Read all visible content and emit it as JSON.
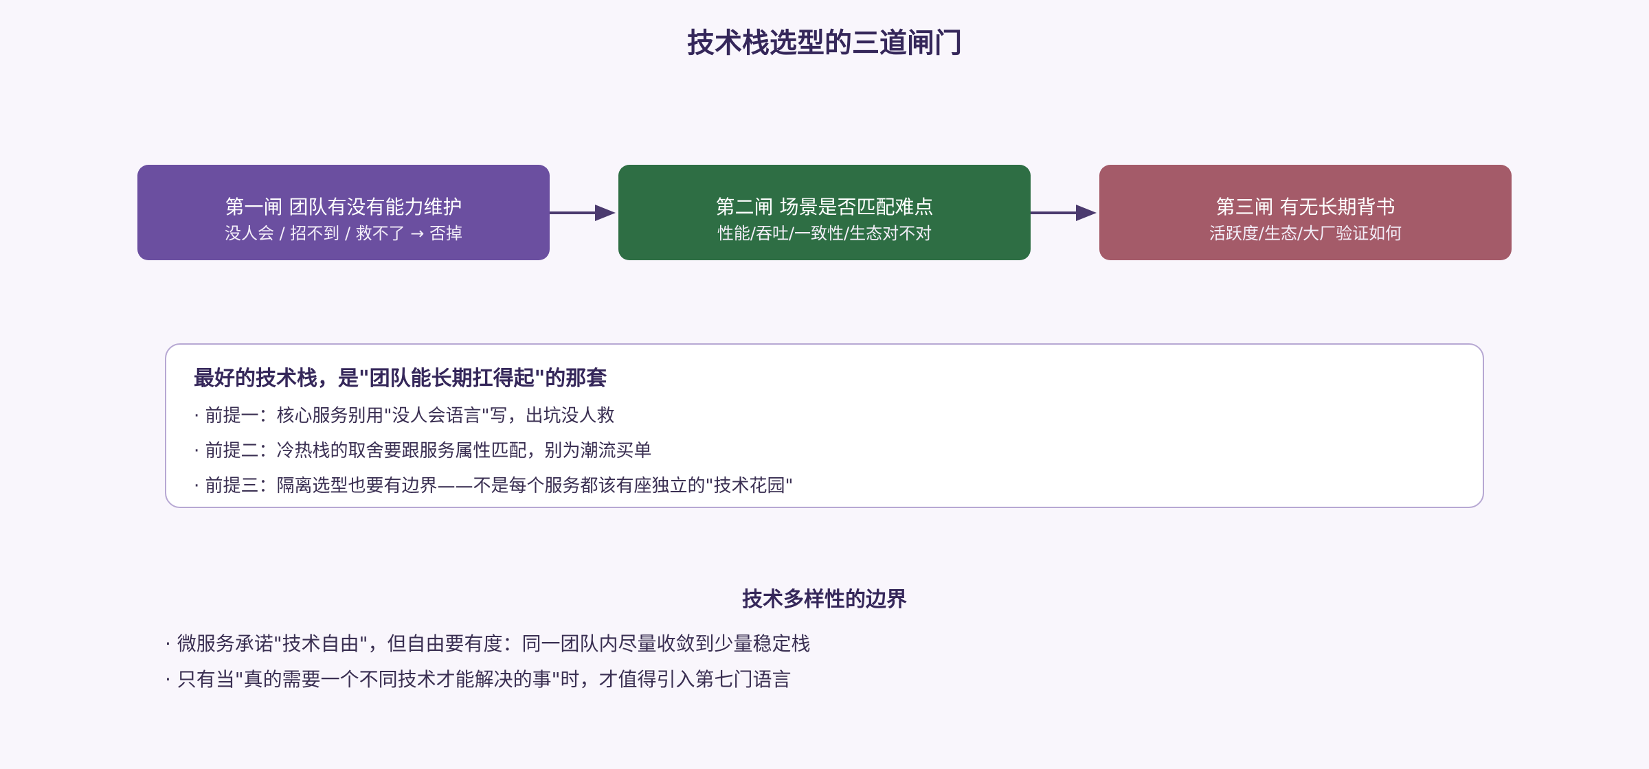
{
  "title": "技术栈选型的三道闸门",
  "gates": [
    {
      "title": "第一闸 团队有没有能力维护",
      "subtitle": "没人会 / 招不到 / 救不了 → 否掉",
      "color": "#6b4fa0"
    },
    {
      "title": "第二闸 场景是否匹配难点",
      "subtitle": "性能/吞吐/一致性/生态对不对",
      "color": "#2e6e44"
    },
    {
      "title": "第三闸 有无长期背书",
      "subtitle": "活跃度/生态/大厂验证如何",
      "color": "#a45b69"
    }
  ],
  "principle": {
    "heading": "最好的技术栈，是\"团队能长期扛得起\"的那套",
    "items": [
      "· 前提一：核心服务别用\"没人会语言\"写，出坑没人救",
      "· 前提二：冷热栈的取舍要跟服务属性匹配，别为潮流买单",
      "· 前提三：隔离选型也要有边界——不是每个服务都该有座独立的\"技术花园\""
    ]
  },
  "diversity": {
    "heading": "技术多样性的边界",
    "items": [
      "· 微服务承诺\"技术自由\"，但自由要有度：同一团队内尽量收敛到少量稳定栈",
      "· 只有当\"真的需要一个不同技术才能解决的事\"时，才值得引入第七门语言"
    ]
  },
  "colors": {
    "arrow": "#4b3a6e",
    "box_border": "#b7a8d3"
  }
}
